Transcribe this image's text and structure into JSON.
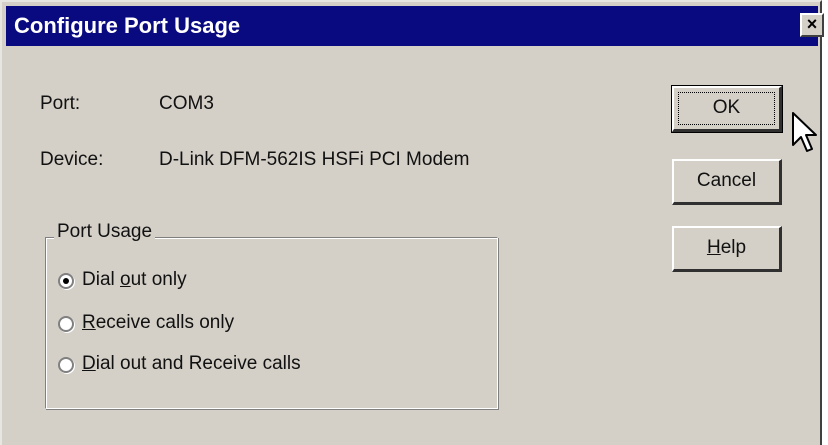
{
  "window": {
    "title": "Configure Port Usage",
    "close_label": "×"
  },
  "info": {
    "port_label": "Port:",
    "port_value": "COM3",
    "device_label": "Device:",
    "device_value": "D-Link DFM-562IS HSFi PCI Modem"
  },
  "buttons": {
    "ok": "OK",
    "cancel": "Cancel",
    "help_mnemonic": "H",
    "help_rest": "elp"
  },
  "port_usage": {
    "legend": "Port Usage",
    "options": [
      {
        "pre": "Dial ",
        "mnemonic": "o",
        "post": "ut only",
        "selected": true
      },
      {
        "pre": "",
        "mnemonic": "R",
        "post": "eceive calls only",
        "selected": false
      },
      {
        "pre": "",
        "mnemonic": "D",
        "post": "ial out and Receive calls",
        "selected": false
      }
    ]
  }
}
